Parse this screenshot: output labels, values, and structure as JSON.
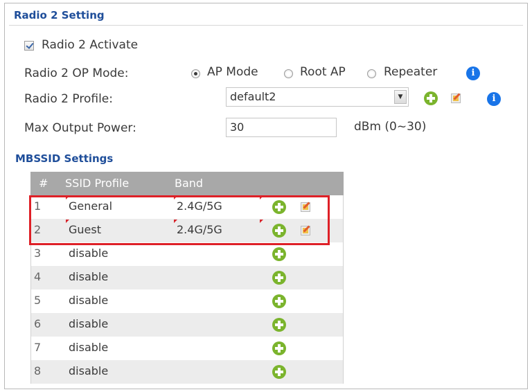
{
  "radio": {
    "section_title": "Radio 2 Setting",
    "activate_label": "Radio 2 Activate",
    "op_mode_label": "Radio 2 OP Mode:",
    "op_modes": [
      "AP Mode",
      "Root AP",
      "Repeater"
    ],
    "op_mode_selected": "AP Mode",
    "profile_label": "Radio 2 Profile:",
    "profile_value": "default2",
    "power_label": "Max Output Power:",
    "power_value": "30",
    "power_unit": "dBm (0~30)"
  },
  "mbssid": {
    "section_title": "MBSSID Settings",
    "headers": [
      "#",
      "SSID Profile",
      "Band"
    ],
    "rows": [
      {
        "num": "1",
        "profile": "General",
        "band": "2.4G/5G"
      },
      {
        "num": "2",
        "profile": "Guest",
        "band": "2.4G/5G"
      },
      {
        "num": "3",
        "profile": "disable",
        "band": ""
      },
      {
        "num": "4",
        "profile": "disable",
        "band": ""
      },
      {
        "num": "5",
        "profile": "disable",
        "band": ""
      },
      {
        "num": "6",
        "profile": "disable",
        "band": ""
      },
      {
        "num": "7",
        "profile": "disable",
        "band": ""
      },
      {
        "num": "8",
        "profile": "disable",
        "band": ""
      }
    ]
  },
  "colors": {
    "accent": "#1f4e9a",
    "add": "#7bb42d",
    "highlight": "#de2027",
    "info": "#1874e8"
  },
  "icons": [
    "checkbox-icon",
    "info-icon",
    "add-icon",
    "edit-icon",
    "dropdown-arrow-icon"
  ]
}
